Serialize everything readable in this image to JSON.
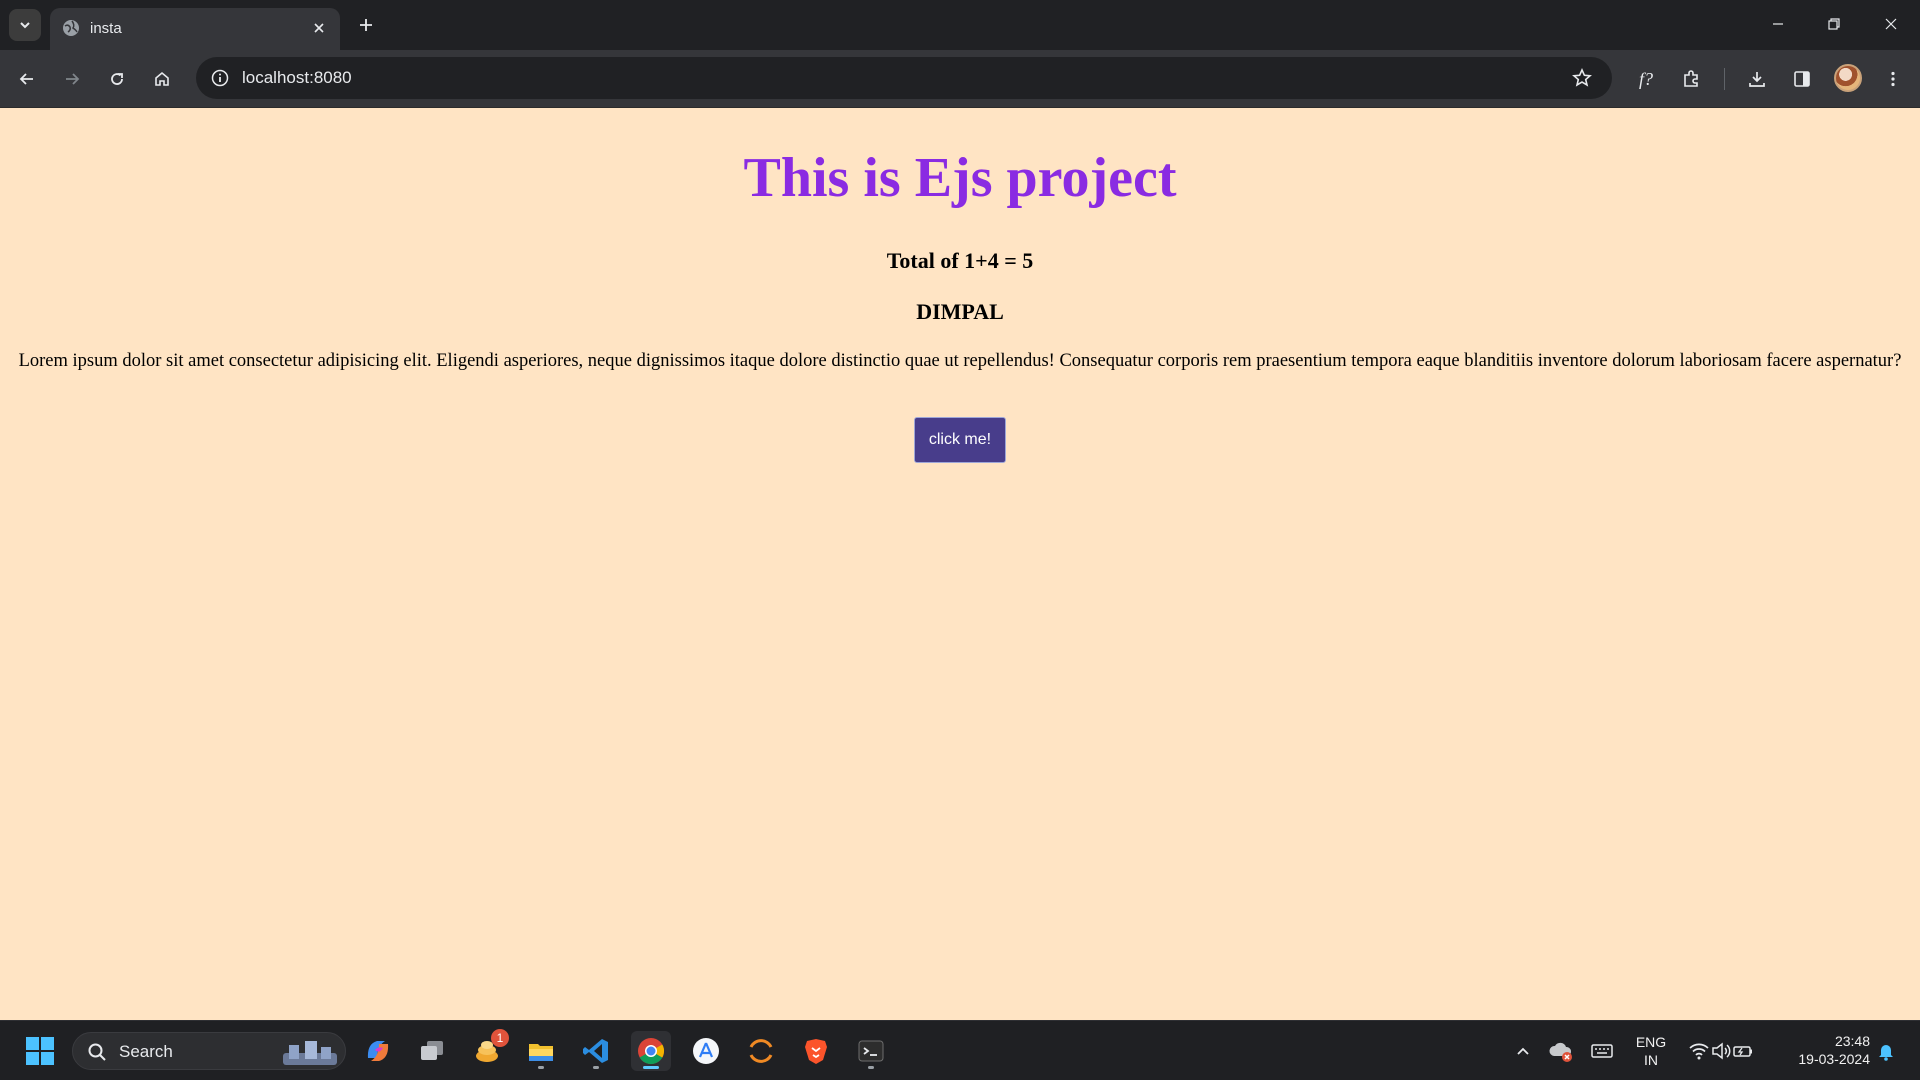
{
  "browser": {
    "tab_title": "insta",
    "url": "localhost:8080"
  },
  "page": {
    "heading": "This is Ejs project",
    "total": "Total of 1+4 = 5",
    "name": "DIMPAL",
    "paragraph": "Lorem ipsum dolor sit amet consectetur adipisicing elit. Eligendi asperiores, neque dignissimos itaque dolore distinctio quae ut repellendus! Consequatur corporis rem praesentium tempora eaque blanditiis inventore dolorum laboriosam facere aspernatur?",
    "button_label": "click me!",
    "colors": {
      "background": "#ffe4c4",
      "heading": "#8a2be2",
      "button": "#483d8b"
    }
  },
  "taskbar": {
    "search_label": "Search",
    "notification_count": "1",
    "language": "ENG",
    "region": "IN",
    "time": "23:48",
    "date": "19-03-2024",
    "pinned": [
      "windows-start-icon",
      "copilot-icon",
      "task-view-icon",
      "app-icon",
      "file-explorer-icon",
      "vscode-icon",
      "chrome-icon",
      "app-store-icon",
      "eclipse-icon",
      "brave-icon",
      "terminal-icon"
    ]
  }
}
